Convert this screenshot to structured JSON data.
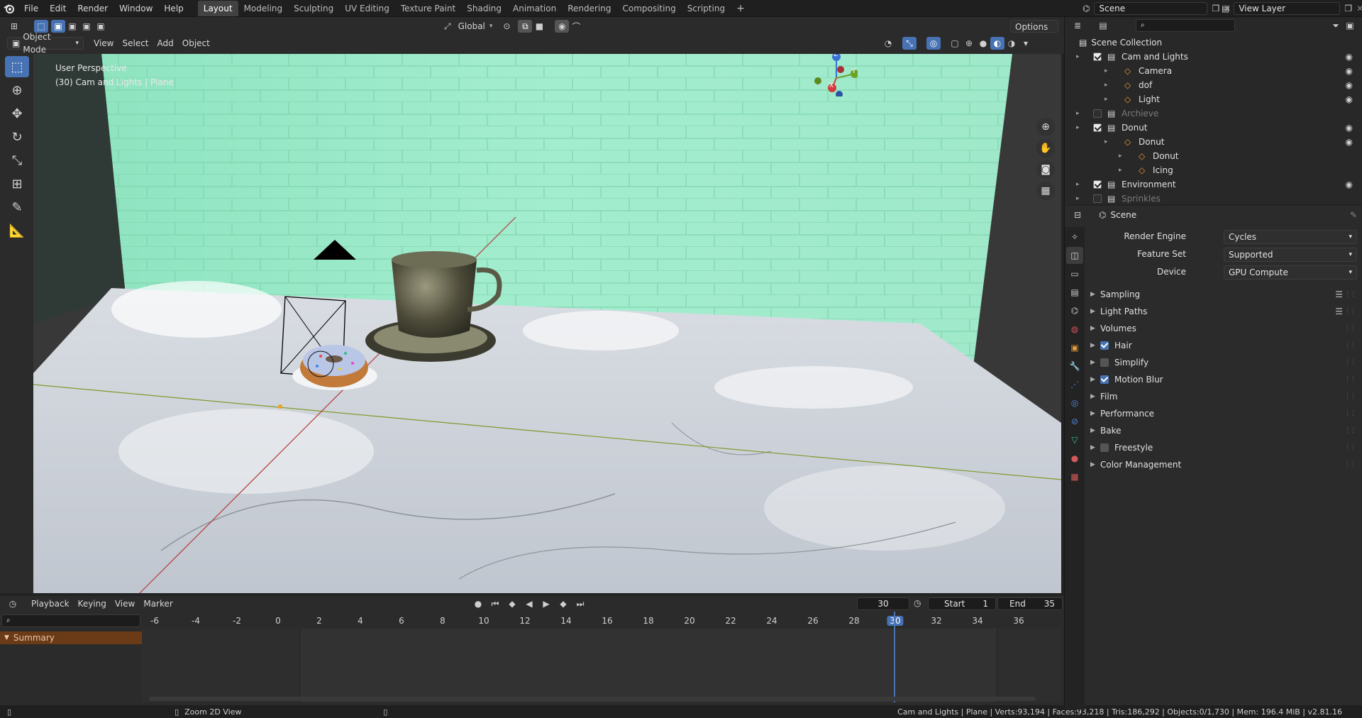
{
  "menu": {
    "file": "File",
    "edit": "Edit",
    "render": "Render",
    "window": "Window",
    "help": "Help"
  },
  "workspaces": [
    "Layout",
    "Modeling",
    "Sculpting",
    "UV Editing",
    "Texture Paint",
    "Shading",
    "Animation",
    "Rendering",
    "Compositing",
    "Scripting"
  ],
  "active_workspace": "Layout",
  "scene_field": "Scene",
  "view_layer_field": "View Layer",
  "viewport_header": {
    "mode": "Object Mode",
    "view": "View",
    "select": "Select",
    "add": "Add",
    "object": "Object",
    "transform_orientation": "Global",
    "options": "Options"
  },
  "viewport": {
    "perspective": "User Perspective",
    "context": "(30) Cam and Lights | Plane",
    "gizmo": {
      "x": "X",
      "y": "Y",
      "z": "Z"
    }
  },
  "outliner": {
    "root": "Scene Collection",
    "items": [
      {
        "label": "Cam and Lights",
        "level": 0,
        "checked": true,
        "dim": false
      },
      {
        "label": "Camera",
        "level": 1,
        "checked": null,
        "dim": false
      },
      {
        "label": "dof",
        "level": 1,
        "checked": null,
        "dim": false
      },
      {
        "label": "Light",
        "level": 1,
        "checked": null,
        "dim": false
      },
      {
        "label": "Archieve",
        "level": 0,
        "checked": false,
        "dim": true
      },
      {
        "label": "Donut",
        "level": 0,
        "checked": true,
        "dim": false
      },
      {
        "label": "Donut",
        "level": 1,
        "checked": null,
        "dim": false
      },
      {
        "label": "Donut",
        "level": 2,
        "checked": null,
        "dim": false
      },
      {
        "label": "Icing",
        "level": 2,
        "checked": null,
        "dim": false
      },
      {
        "label": "Environment",
        "level": 0,
        "checked": true,
        "dim": false
      },
      {
        "label": "Sprinkles",
        "level": 0,
        "checked": false,
        "dim": true
      }
    ]
  },
  "properties": {
    "context": "Scene",
    "render_engine_label": "Render Engine",
    "render_engine": "Cycles",
    "feature_set_label": "Feature Set",
    "feature_set": "Supported",
    "device_label": "Device",
    "device": "GPU Compute",
    "panels": [
      {
        "label": "Sampling",
        "checkbox": null
      },
      {
        "label": "Light Paths",
        "checkbox": null
      },
      {
        "label": "Volumes",
        "checkbox": null
      },
      {
        "label": "Hair",
        "checkbox": true
      },
      {
        "label": "Simplify",
        "checkbox": false
      },
      {
        "label": "Motion Blur",
        "checkbox": true
      },
      {
        "label": "Film",
        "checkbox": null
      },
      {
        "label": "Performance",
        "checkbox": null
      },
      {
        "label": "Bake",
        "checkbox": null
      },
      {
        "label": "Freestyle",
        "checkbox": false
      },
      {
        "label": "Color Management",
        "checkbox": null
      }
    ]
  },
  "timeline": {
    "playback": "Playback",
    "keying": "Keying",
    "view": "View",
    "marker": "Marker",
    "current_frame": "30",
    "start_label": "Start",
    "start": "1",
    "end_label": "End",
    "end": "35",
    "summary": "Summary",
    "ticks": [
      "-6",
      "-4",
      "-2",
      "0",
      "2",
      "4",
      "6",
      "8",
      "10",
      "12",
      "14",
      "16",
      "18",
      "20",
      "22",
      "24",
      "26",
      "28",
      "30",
      "32",
      "34",
      "36"
    ]
  },
  "statusbar": {
    "hint": "Zoom 2D View",
    "stats": "Cam and Lights | Plane | Verts:93,194 | Faces:93,218 | Tris:186,292 | Objects:0/1,730 | Mem: 196.4 MiB | v2.81.16"
  },
  "colors": {
    "accent": "#4772b3",
    "wall": "#9ee8c7",
    "frame_marker": "#4772b3"
  }
}
